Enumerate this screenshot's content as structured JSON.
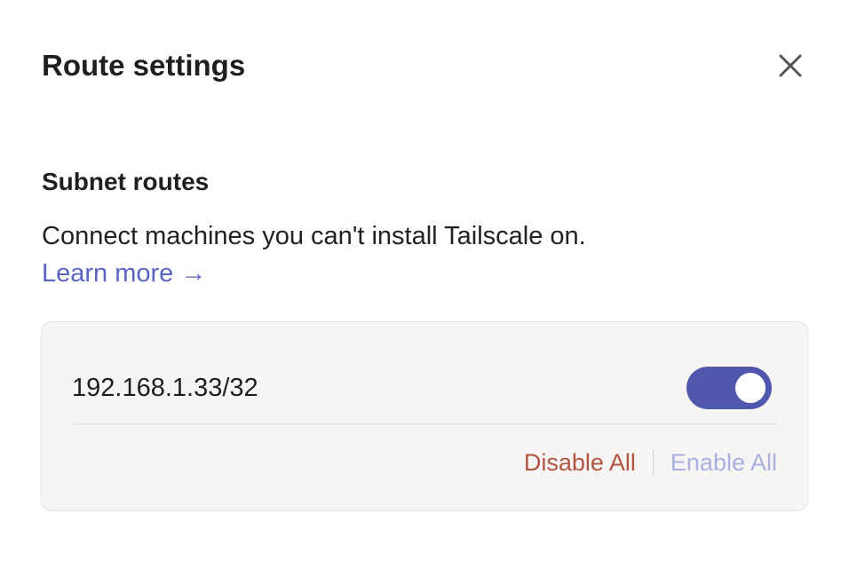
{
  "dialog": {
    "title": "Route settings",
    "close_icon": "close-icon"
  },
  "subnet": {
    "heading": "Subnet routes",
    "description": "Connect machines you can't install Tailscale on.",
    "learn_more": "Learn more →",
    "routes": [
      {
        "cidr": "192.168.1.33/32",
        "enabled": true
      }
    ],
    "disable_all_label": "Disable All",
    "enable_all_label": "Enable All"
  },
  "colors": {
    "accent": "#5058ad",
    "link": "#5b64c0",
    "danger": "#b0533f",
    "disabled_action": "#aab0e0",
    "card_bg": "#f6f5f4"
  }
}
